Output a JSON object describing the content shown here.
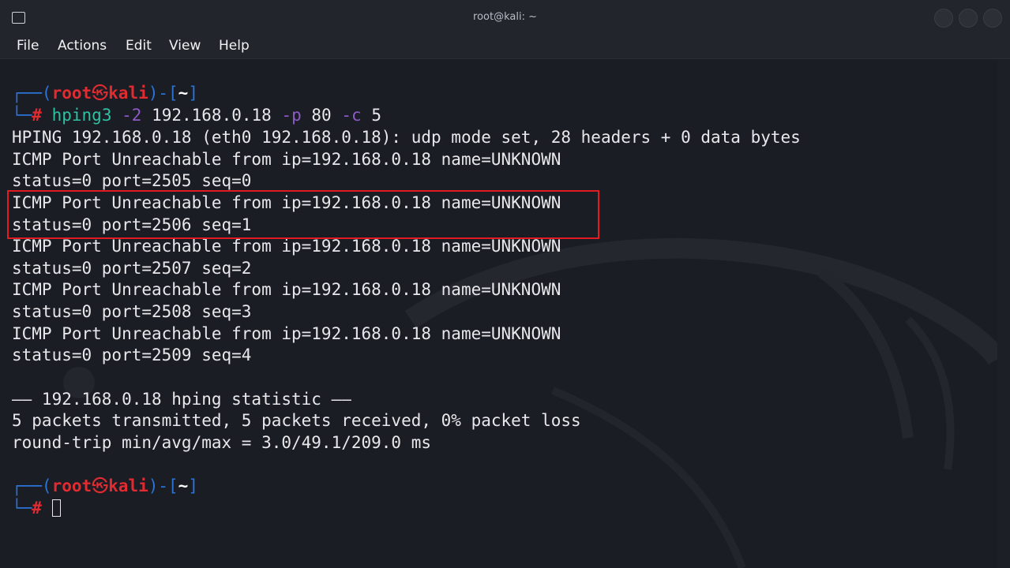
{
  "window": {
    "title": "root@kali: ~",
    "accent_color": "#2f7de1"
  },
  "menubar": {
    "items": [
      "File",
      "Actions",
      "Edit",
      "View",
      "Help"
    ]
  },
  "prompt": {
    "user": "root",
    "skull": "㉿",
    "host": "kali",
    "dir": "~",
    "symbol": "#"
  },
  "command": {
    "tool": "hping3",
    "opt1": "-2",
    "target": "192.168.0.18",
    "opt2": "-p",
    "port": "80",
    "opt3": "-c",
    "count": "5"
  },
  "output": {
    "header": "HPING 192.168.0.18 (eth0 192.168.0.18): udp mode set, 28 headers + 0 data bytes",
    "lines": [
      "ICMP Port Unreachable from ip=192.168.0.18 name=UNKNOWN",
      "status=0 port=2505 seq=0",
      "ICMP Port Unreachable from ip=192.168.0.18 name=UNKNOWN",
      "status=0 port=2506 seq=1",
      "ICMP Port Unreachable from ip=192.168.0.18 name=UNKNOWN",
      "status=0 port=2507 seq=2",
      "ICMP Port Unreachable from ip=192.168.0.18 name=UNKNOWN",
      "status=0 port=2508 seq=3",
      "ICMP Port Unreachable from ip=192.168.0.18 name=UNKNOWN",
      "status=0 port=2509 seq=4"
    ],
    "stat_header": "—— 192.168.0.18 hping statistic ——",
    "stat_packets": "5 packets transmitted, 5 packets received, 0% packet loss",
    "stat_rtt": "round-trip min/avg/max = 3.0/49.1/209.0 ms"
  },
  "colors": {
    "background": "#1b1d24",
    "prompt_red": "#e02b31",
    "prompt_blue": "#2b74d6",
    "command_green": "#2ec1a2",
    "option_purple": "#8d5ac6",
    "highlight_box": "#e01b22"
  },
  "icons": {
    "app": "terminal-icon",
    "cursor": "block-cursor"
  }
}
